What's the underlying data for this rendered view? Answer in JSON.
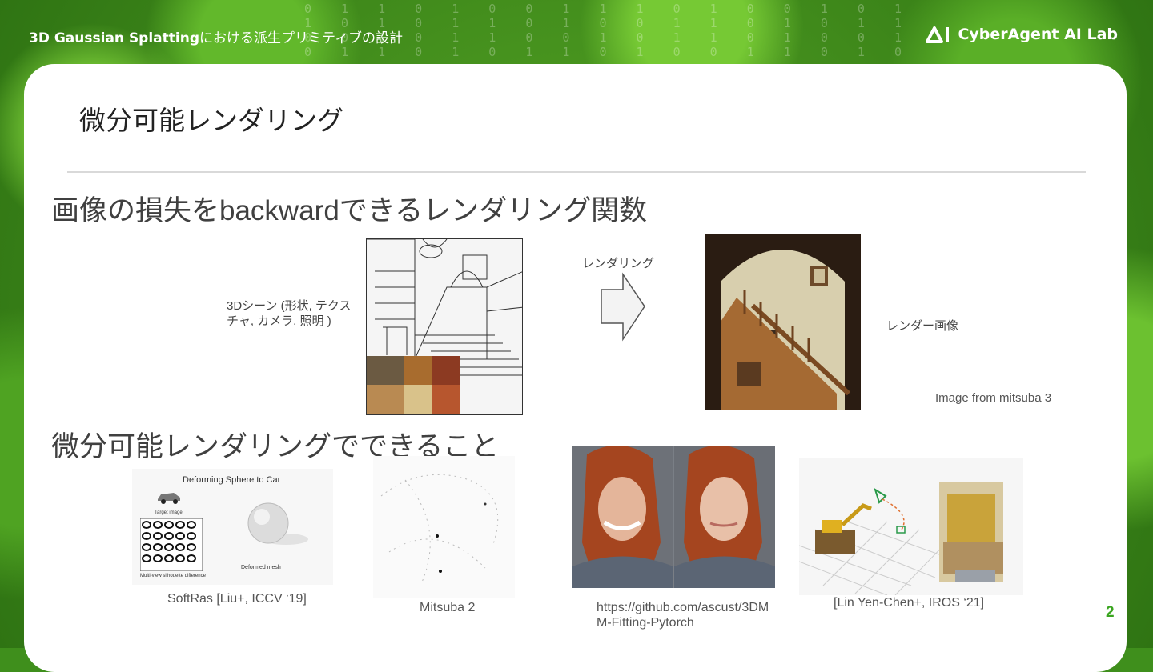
{
  "header": {
    "title_bold": "3D Gaussian Splatting",
    "title_rest": "における派生プリミティブの設計",
    "logo_text": "CyberAgent AI Lab",
    "background_digits": "0 1 1 0 1 0 0 1 1 1 0 1 0 0 1 0 1 1 0 1 0 1 1 0 1 0 0 1 1 0 1 0 1 1 0 0 1 0 1 1 0 0 1 0 1 1 0 1 0 0 1 0 1 1 0 1 0 1 1 0 1 0 0 1 1 0 1 0 1"
  },
  "slide": {
    "title": "微分可能レンダリング",
    "heading1": "画像の損失をbackwardできるレンダリング関数",
    "scene_label": "3Dシーン (形状, テクスチャ, カメラ, 照明 )",
    "arrow_label": "レンダリング",
    "render_label": "レンダー画像",
    "image_credit": "Image from mitsuba 3",
    "heading2": "微分可能レンダリングでできること",
    "examples": [
      {
        "caption": "SoftRas [Liu+, ICCV ‘19]",
        "figure_title": "Deforming Sphere to Car",
        "target_label": "Target image",
        "mesh_label": "Deformed mesh",
        "silhouette_label": "Multi-view silhouette difference"
      },
      {
        "caption": "Mitsuba 2"
      },
      {
        "caption": "https://github.com/ascust/3DMM-Fitting-Pytorch"
      },
      {
        "caption": "[Lin Yen-Chen+, IROS ‘21]"
      }
    ],
    "page_number": "2"
  },
  "colors": {
    "accent_green": "#3aa520",
    "text_dark": "#222222",
    "heading_gray": "#404040"
  }
}
